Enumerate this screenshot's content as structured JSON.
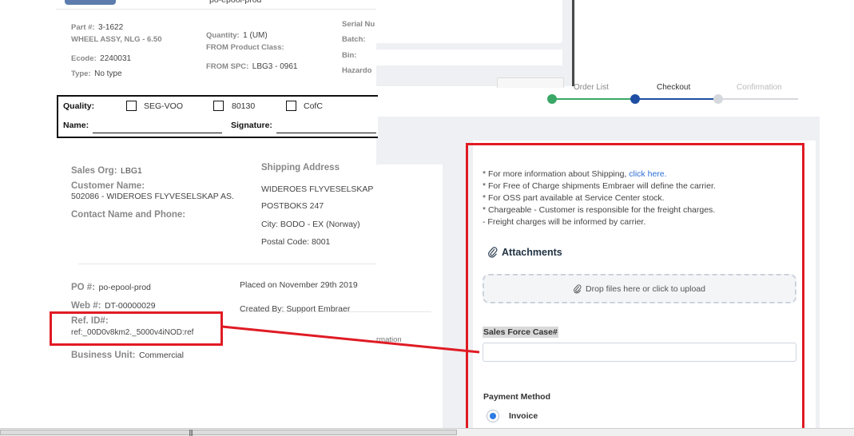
{
  "doc": {
    "top_partial_value": "po-epool-prod",
    "part": {
      "label": "Part #:",
      "value": "3-1622",
      "description": "WHEEL ASSY, NLG - 6.50",
      "ecode_label": "Ecode:",
      "ecode_value": "2240031",
      "type_label": "Type:",
      "type_value": "No type"
    },
    "qty": {
      "quantity_label": "Quantity:",
      "quantity_value": "1 (UM)",
      "product_class_label": "FROM Product Class:",
      "spc_label": "FROM SPC:",
      "spc_value": "LBG3 - 0961"
    },
    "right_col": {
      "serial_label": "Serial Nu",
      "batch_label": "Batch:",
      "bin_label": "Bin:",
      "hazard_label": "Hazardo"
    },
    "quality": {
      "label": "Quality:",
      "options": [
        "SEG-VOO",
        "80130",
        "CofC"
      ],
      "name_label": "Name:",
      "signature_label": "Signature:"
    },
    "sales_org_label": "Sales Org:",
    "sales_org_value": "LBG1",
    "customer_name_label": "Customer Name:",
    "customer_name_value": "502086 - WIDEROES FLYVESELSKAP AS.",
    "contact_label": "Contact Name and Phone:",
    "shipping": {
      "title": "Shipping Address",
      "name": "WIDEROES FLYVESELSKAP",
      "po_box": "POSTBOKS 247",
      "city": "City: BODO - EX (Norway)",
      "postal": "Postal Code: 8001"
    },
    "po_label": "PO #:",
    "po_value": "po-epool-prod",
    "web_label": "Web #:",
    "web_value": "DT-00000029",
    "ref_label": "Ref. ID#:",
    "ref_value": "ref:_00D0v8km2._5000v4iNOD:ref",
    "bu_label": "Business Unit:",
    "bu_value": "Commercial",
    "placed_on": "Placed on November 29th 2019",
    "created_by": "Created By: Support Embraer",
    "hidden_partial": "rmation"
  },
  "stepper": {
    "steps": [
      "Order List",
      "Checkout",
      "Confirmation"
    ],
    "colors": {
      "done": "#3aa767",
      "active": "#1f4fa3",
      "todo": "#d5d8dc"
    }
  },
  "checkout": {
    "notes": [
      {
        "text": "* For more information about Shipping, ",
        "link": "click here."
      },
      {
        "text": "* For Free of Charge shipments Embraer will define the carrier."
      },
      {
        "text": "* For OSS part available at Service Center stock."
      },
      {
        "text": "* Chargeable - Customer is responsible for the freight charges."
      },
      {
        "text": "- Freight charges will be informed by carrier."
      }
    ],
    "attachments_title": "Attachments",
    "dropzone_text": "Drop files here or click to upload",
    "sales_force_label": "Sales Force Case#",
    "sales_force_value": "",
    "payment_method_label": "Payment Method",
    "invoice_label": "Invoice"
  },
  "colors": {
    "highlight": "#e01b24",
    "link": "#2a6fd6",
    "radio": "#2d7be5"
  }
}
